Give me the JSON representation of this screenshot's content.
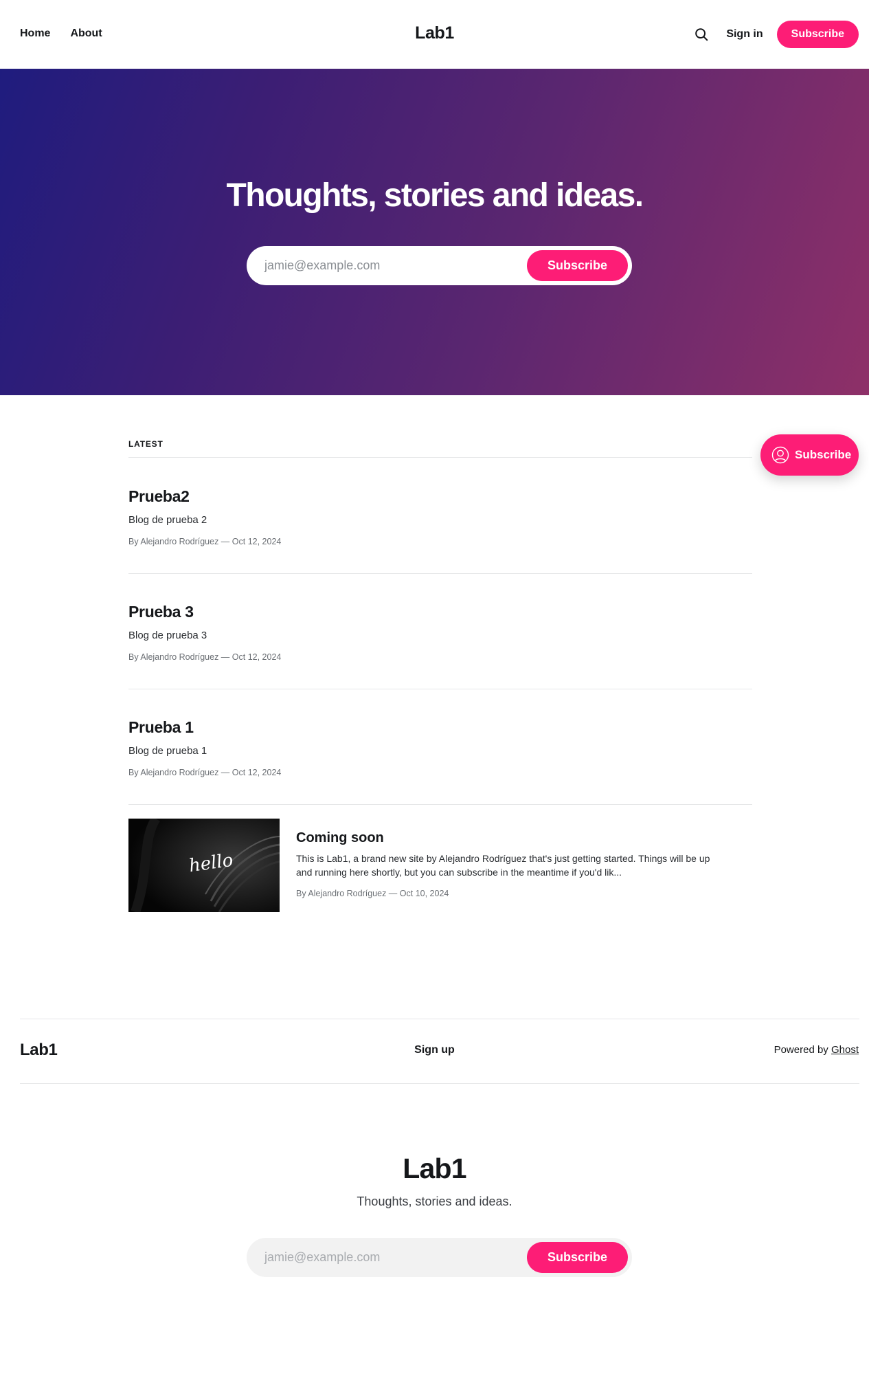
{
  "header": {
    "nav": [
      {
        "label": "Home"
      },
      {
        "label": "About"
      }
    ],
    "site_title": "Lab1",
    "signin_label": "Sign in",
    "subscribe_label": "Subscribe"
  },
  "hero": {
    "title": "Thoughts, stories and ideas.",
    "email_placeholder": "jamie@example.com",
    "subscribe_label": "Subscribe"
  },
  "feed": {
    "section_label": "LATEST",
    "posts": [
      {
        "title": "Prueba2",
        "excerpt": "Blog de prueba 2",
        "meta": "By Alejandro Rodríguez — Oct 12, 2024"
      },
      {
        "title": "Prueba 3",
        "excerpt": "Blog de prueba 3",
        "meta": "By Alejandro Rodríguez — Oct 12, 2024"
      },
      {
        "title": "Prueba 1",
        "excerpt": "Blog de prueba 1",
        "meta": "By Alejandro Rodríguez — Oct 12, 2024"
      }
    ],
    "featured": {
      "image_text": "hello",
      "title": "Coming soon",
      "excerpt": "This is Lab1, a brand new site by Alejandro Rodríguez that's just getting started. Things will be up and running here shortly, but you can subscribe in the meantime if you'd lik...",
      "meta": "By Alejandro Rodríguez — Oct 10, 2024"
    }
  },
  "portal": {
    "label": "Subscribe",
    "icon": "user-circle-icon"
  },
  "footer": {
    "site_title": "Lab1",
    "signup_label": "Sign up",
    "powered_prefix": "Powered by",
    "powered_link": "Ghost"
  },
  "cta": {
    "title": "Lab1",
    "subtitle": "Thoughts, stories and ideas.",
    "email_placeholder": "jamie@example.com",
    "subscribe_label": "Subscribe"
  },
  "colors": {
    "accent": "#fd1d76",
    "hero_gradient_start": "#1f1c7e",
    "hero_gradient_end": "#8e3068"
  }
}
